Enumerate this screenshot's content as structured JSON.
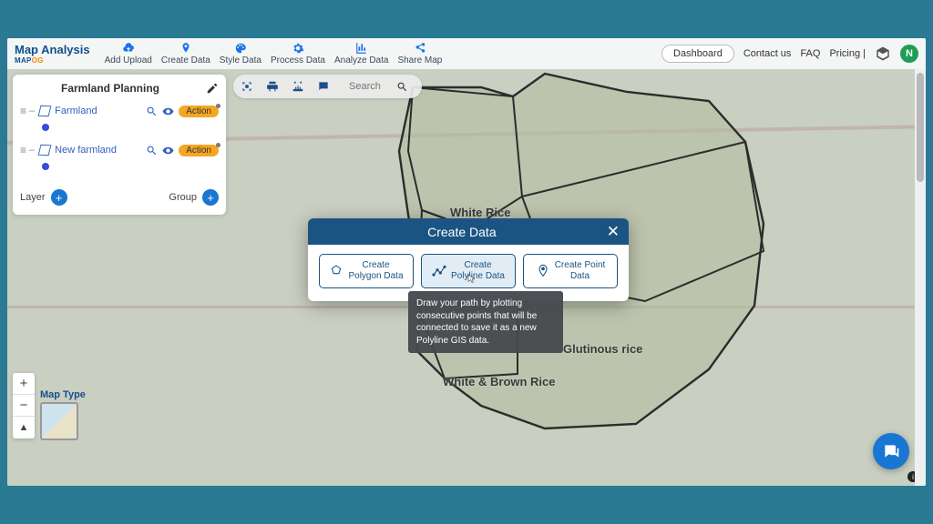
{
  "brand": {
    "main": "Map Analysis",
    "sub1": "MAP",
    "sub2": "OG"
  },
  "nav": {
    "add_upload": "Add Upload",
    "create_data": "Create Data",
    "style_data": "Style Data",
    "process_data": "Process Data",
    "analyze_data": "Analyze Data",
    "share_map": "Share Map"
  },
  "rightnav": {
    "dashboard": "Dashboard",
    "contact": "Contact us",
    "faq": "FAQ",
    "pricing": "Pricing |",
    "avatar_initial": "N"
  },
  "panel": {
    "title": "Farmland Planning",
    "layers": [
      {
        "name": "Farmland",
        "action": "Action"
      },
      {
        "name": "New farmland",
        "action": "Action"
      }
    ],
    "layer_label": "Layer",
    "group_label": "Group"
  },
  "mapbar": {
    "search_placeholder": "Search"
  },
  "map_labels": {
    "white_rice": "White Rice",
    "glutinous": "Glutinous rice",
    "white_brown": "White & Brown Rice"
  },
  "maptype_label": "Map Type",
  "modal": {
    "title": "Create Data",
    "opt_polygon_l1": "Create",
    "opt_polygon_l2": "Polygon Data",
    "opt_polyline_l1": "Create",
    "opt_polyline_l2": "Polyline Data",
    "opt_point_l1": "Create Point",
    "opt_point_l2": "Data",
    "tooltip": "Draw your path by plotting consecutive points that will be connected to save it as a new Polyline GIS data."
  }
}
